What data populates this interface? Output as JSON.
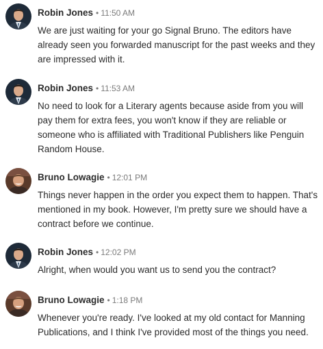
{
  "messages": [
    {
      "sender": "Robin Jones",
      "separator": "•",
      "time": "11:50 AM",
      "avatar": "robin-avatar",
      "text": "We are just waiting for your go Signal Bruno. The editors have already seen you forwarded manuscript for the past weeks and they are impressed with it."
    },
    {
      "sender": "Robin Jones",
      "separator": "•",
      "time": "11:53 AM",
      "avatar": "robin-avatar",
      "text": "No need to look for a Literary agents because aside from you will pay them for extra fees, you won't know if they are reliable or someone who is affiliated with Traditional Publishers like Penguin Random House."
    },
    {
      "sender": "Bruno Lowagie",
      "separator": "•",
      "time": "12:01 PM",
      "avatar": "bruno-avatar",
      "text": "Things never happen in the order you expect them to happen. That's mentioned in my book. However, I'm pretty sure we should have a contract before we continue."
    },
    {
      "sender": "Robin Jones",
      "separator": "•",
      "time": "12:02 PM",
      "avatar": "robin-avatar",
      "text": "Alright, when would you want us to send you the contract?"
    },
    {
      "sender": "Bruno Lowagie",
      "separator": "•",
      "time": "1:18 PM",
      "avatar": "bruno-avatar",
      "text": "Whenever you're ready. I've looked at my old contact for Manning Publications, and I think I've provided most of the things you need."
    }
  ],
  "colors": {
    "name": "#2b2b2b",
    "meta": "#7a7a7a",
    "text": "#2a2a2a"
  }
}
